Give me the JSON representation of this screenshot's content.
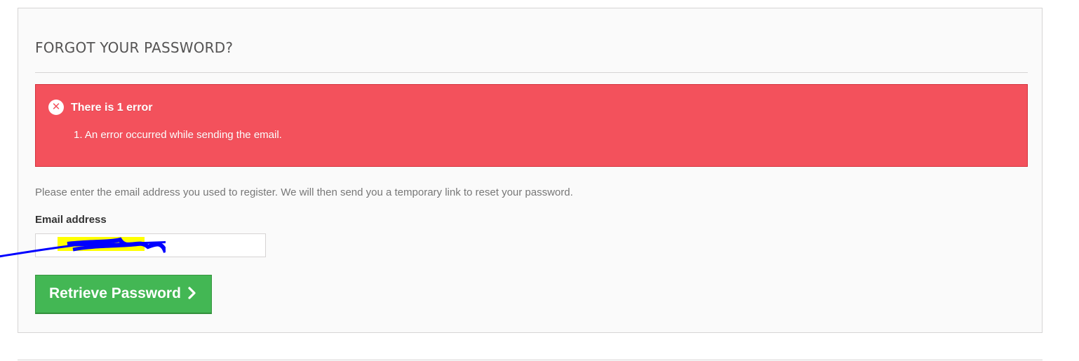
{
  "form": {
    "heading": "FORGOT YOUR PASSWORD?",
    "error_alert": {
      "title": "There is 1 error",
      "items": [
        "An error occurred while sending the email."
      ]
    },
    "instructions": "Please enter the email address you used to register. We will then send you a temporary link to reset your password.",
    "email_label": "Email address",
    "submit_label": "Retrieve Password"
  },
  "colors": {
    "alert_background": "#f3515c",
    "button_background": "#43b754",
    "redaction_scribble": "#0000ff",
    "redaction_highlight": "#ffff00"
  },
  "icons": [
    "close-circle-icon",
    "chevron-right-icon"
  ]
}
